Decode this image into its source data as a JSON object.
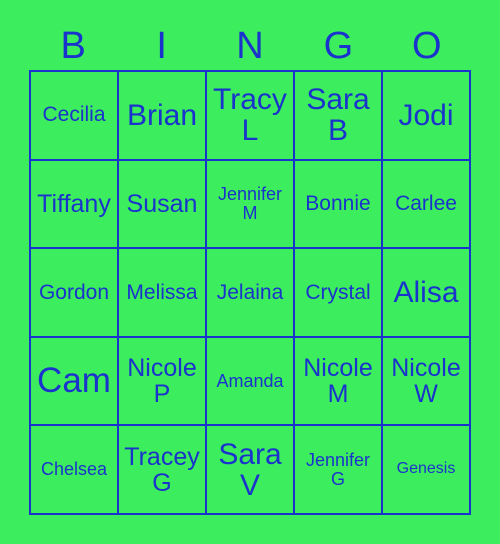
{
  "card": {
    "title_letters": [
      "B",
      "I",
      "N",
      "G",
      "O"
    ],
    "colors": {
      "background": "#3ced5d",
      "text": "#1a33cc",
      "gridline": "#1a33cc"
    },
    "rows": [
      [
        {
          "name": "Cecilia",
          "size": "fs-m"
        },
        {
          "name": "Brian",
          "size": "fs-xl"
        },
        {
          "name": "Tracy L",
          "size": "fs-xl"
        },
        {
          "name": "Sara B",
          "size": "fs-xl"
        },
        {
          "name": "Jodi",
          "size": "fs-xl"
        }
      ],
      [
        {
          "name": "Tiffany",
          "size": "fs-l"
        },
        {
          "name": "Susan",
          "size": "fs-l"
        },
        {
          "name": "Jennifer M",
          "size": "fs-s"
        },
        {
          "name": "Bonnie",
          "size": "fs-m"
        },
        {
          "name": "Carlee",
          "size": "fs-m"
        }
      ],
      [
        {
          "name": "Gordon",
          "size": "fs-m"
        },
        {
          "name": "Melissa",
          "size": "fs-m"
        },
        {
          "name": "Jelaina",
          "size": "fs-m"
        },
        {
          "name": "Crystal",
          "size": "fs-m"
        },
        {
          "name": "Alisa",
          "size": "fs-xl"
        }
      ],
      [
        {
          "name": "Cam",
          "size": "fs-xxl"
        },
        {
          "name": "Nicole P",
          "size": "fs-l"
        },
        {
          "name": "Amanda",
          "size": "fs-s"
        },
        {
          "name": "Nicole M",
          "size": "fs-l"
        },
        {
          "name": "Nicole W",
          "size": "fs-l"
        }
      ],
      [
        {
          "name": "Chelsea",
          "size": "fs-s"
        },
        {
          "name": "Tracey G",
          "size": "fs-l"
        },
        {
          "name": "Sara V",
          "size": "fs-xl"
        },
        {
          "name": "Jennifer G",
          "size": "fs-s"
        },
        {
          "name": "Genesis",
          "size": "fs-xs"
        }
      ]
    ]
  }
}
